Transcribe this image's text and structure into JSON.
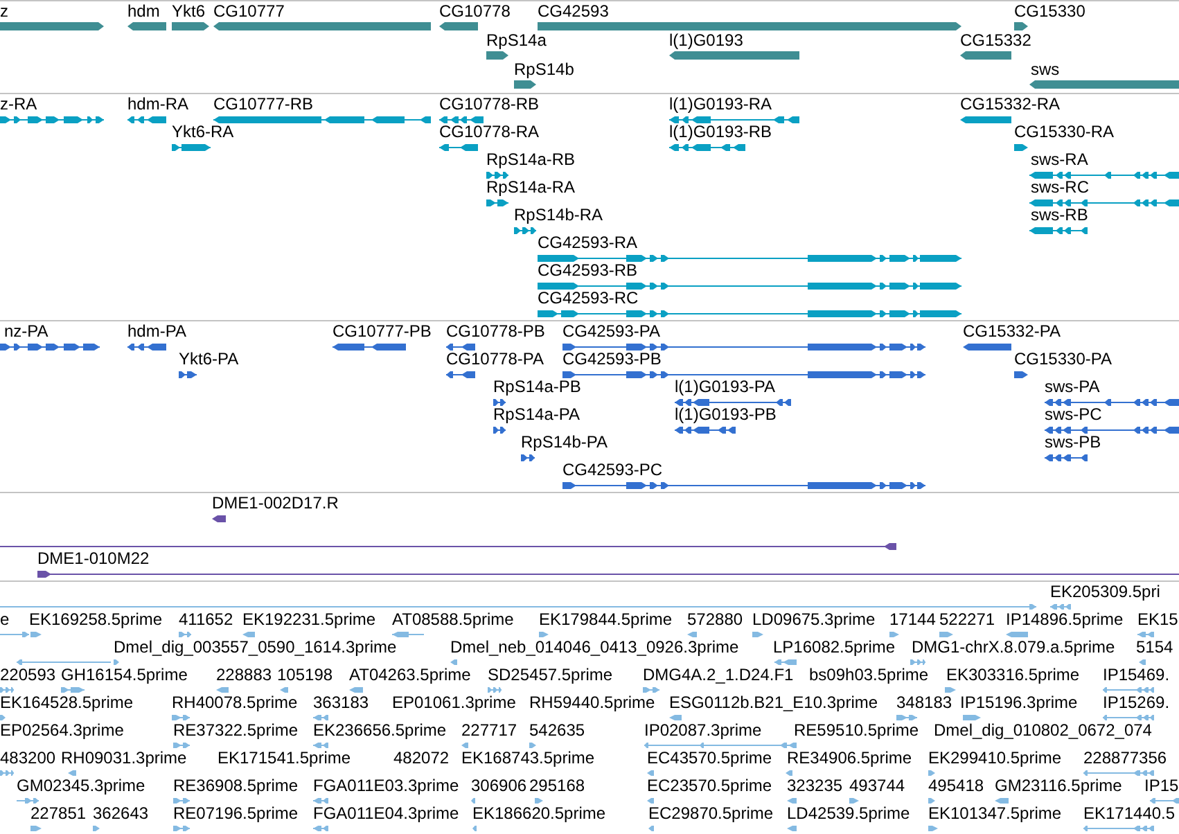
{
  "tracks": [
    {
      "kind": "gene",
      "rows": [
        {
          "features": [
            {
              "label": "z",
              "reverse": false
            },
            {
              "label": "hdm",
              "reverse": true
            },
            {
              "label": "Ykt6",
              "reverse": false
            },
            {
              "label": "CG10777",
              "reverse": true
            },
            {
              "label": "CG10778",
              "reverse": true
            },
            {
              "label": "CG42593",
              "reverse": false
            },
            {
              "label": "CG15330",
              "reverse": false
            }
          ]
        },
        {
          "features": [
            {
              "label": "RpS14a",
              "reverse": false
            },
            {
              "label": "l(1)G0193",
              "reverse": true
            },
            {
              "label": "CG15332",
              "reverse": true
            }
          ]
        },
        {
          "features": [
            {
              "label": "RpS14b",
              "reverse": false
            },
            {
              "label": "sws",
              "reverse": true
            }
          ]
        }
      ]
    },
    {
      "kind": "transcript",
      "rows": [
        {
          "features": [
            {
              "label": "z-RA",
              "reverse": false
            },
            {
              "label": "hdm-RA",
              "reverse": true
            },
            {
              "label": "CG10777-RB",
              "reverse": true
            },
            {
              "label": "CG10778-RB",
              "reverse": true
            },
            {
              "label": "l(1)G0193-RA",
              "reverse": true
            },
            {
              "label": "CG15332-RA",
              "reverse": true
            }
          ]
        },
        {
          "features": [
            {
              "label": "Ykt6-RA",
              "reverse": false
            },
            {
              "label": "CG10778-RA",
              "reverse": true
            },
            {
              "label": "l(1)G0193-RB",
              "reverse": true
            },
            {
              "label": "CG15330-RA",
              "reverse": false
            }
          ]
        },
        {
          "features": [
            {
              "label": "RpS14a-RB",
              "reverse": false
            },
            {
              "label": "sws-RA",
              "reverse": true
            }
          ]
        },
        {
          "features": [
            {
              "label": "RpS14a-RA",
              "reverse": false
            },
            {
              "label": "sws-RC",
              "reverse": true
            }
          ]
        },
        {
          "features": [
            {
              "label": "RpS14b-RA",
              "reverse": false
            },
            {
              "label": "sws-RB",
              "reverse": true
            }
          ]
        },
        {
          "features": [
            {
              "label": "CG42593-RA",
              "reverse": false
            }
          ]
        },
        {
          "features": [
            {
              "label": "CG42593-RB",
              "reverse": false
            }
          ]
        },
        {
          "features": [
            {
              "label": "CG42593-RC",
              "reverse": false
            }
          ]
        }
      ]
    },
    {
      "kind": "protein",
      "rows": [
        {
          "features": [
            {
              "label": "nz-PA",
              "reverse": false
            },
            {
              "label": "hdm-PA",
              "reverse": true
            },
            {
              "label": "CG10777-PB",
              "reverse": true
            },
            {
              "label": "CG10778-PB",
              "reverse": true
            },
            {
              "label": "CG42593-PA",
              "reverse": false
            },
            {
              "label": "CG15332-PA",
              "reverse": true
            }
          ]
        },
        {
          "features": [
            {
              "label": "Ykt6-PA",
              "reverse": false
            },
            {
              "label": "CG10778-PA",
              "reverse": true
            },
            {
              "label": "CG42593-PB",
              "reverse": false
            },
            {
              "label": "CG15330-PA",
              "reverse": false
            }
          ]
        },
        {
          "features": [
            {
              "label": "RpS14a-PB",
              "reverse": false
            },
            {
              "label": "l(1)G0193-PA",
              "reverse": true
            },
            {
              "label": "sws-PA",
              "reverse": true
            }
          ]
        },
        {
          "features": [
            {
              "label": "RpS14a-PA",
              "reverse": false
            },
            {
              "label": "l(1)G0193-PB",
              "reverse": true
            },
            {
              "label": "sws-PC",
              "reverse": true
            }
          ]
        },
        {
          "features": [
            {
              "label": "RpS14b-PA",
              "reverse": false
            },
            {
              "label": "sws-PB",
              "reverse": true
            }
          ]
        },
        {
          "features": [
            {
              "label": "CG42593-PC",
              "reverse": false
            }
          ]
        }
      ]
    },
    {
      "kind": "clone",
      "rows": [
        {
          "features": [
            {
              "label": "DME1-002D17.R",
              "reverse": true
            }
          ]
        },
        {
          "features": [
            {
              "reverse": true
            }
          ]
        },
        {
          "features": [
            {
              "label": "DME1-010M22",
              "reverse": false
            }
          ]
        }
      ]
    },
    {
      "kind": "est",
      "rows": [
        {
          "features": [
            {
              "reverse": false
            },
            {
              "label": "EK205309.5pri",
              "reverse": true
            }
          ]
        },
        {
          "features": [
            {
              "label": "e",
              "reverse": false
            },
            {
              "label": "EK169258.5prime",
              "reverse": false
            },
            {
              "label": "411652",
              "reverse": false
            },
            {
              "label": "EK192231.5prime",
              "reverse": true
            },
            {
              "label": "AT08588.5prime",
              "reverse": true
            },
            {
              "label": "EK179844.5prime",
              "reverse": false
            },
            {
              "label": "572880",
              "reverse": true
            },
            {
              "label": "LD09675.3prime",
              "reverse": false
            },
            {
              "label": "17144",
              "reverse": false
            },
            {
              "label": "522271",
              "reverse": false
            },
            {
              "label": "IP14896.5prime",
              "reverse": true
            },
            {
              "label": "EK15",
              "reverse": true
            }
          ]
        },
        {
          "features": [
            {
              "reverse": true
            },
            {
              "label": "Dmel_dig_003557_0590_1614.3prime",
              "reverse": false
            },
            {
              "label": "Dmel_neb_014046_0413_0926.3prime",
              "reverse": true
            },
            {
              "label": "LP16082.5prime",
              "reverse": true
            },
            {
              "label": "DMG1-chrX.8.079.a.5prime",
              "reverse": false
            },
            {
              "label": "5154",
              "reverse": true
            }
          ]
        },
        {
          "features": [
            {
              "label": "220593",
              "reverse": false
            },
            {
              "label": "GH16154.5prime",
              "reverse": false
            },
            {
              "label": "228883",
              "reverse": true
            },
            {
              "label": "105198",
              "reverse": true
            },
            {
              "label": "AT04263.5prime",
              "reverse": true
            },
            {
              "label": "SD25457.5prime",
              "reverse": false
            },
            {
              "label": "DMG4A.2_1.D24.F1",
              "reverse": false
            },
            {
              "label": "bs09h03.5prime"
            },
            {
              "label": "EK303316.5prime",
              "reverse": false
            },
            {
              "label": "IP15469.",
              "reverse": true
            }
          ]
        },
        {
          "features": [
            {
              "label": "EK164528.5prime",
              "reverse": false
            },
            {
              "label": "RH40078.5prime",
              "reverse": false
            },
            {
              "label": "363183",
              "reverse": true
            },
            {
              "label": "EP01061.3prime"
            },
            {
              "label": "RH59440.5prime"
            },
            {
              "label": "ESG0112b.B21_E10.3prime",
              "reverse": true
            },
            {
              "label": "348183",
              "reverse": false
            },
            {
              "label": "IP15196.3prime",
              "reverse": false
            },
            {
              "label": "IP15269.",
              "reverse": true
            }
          ]
        },
        {
          "features": [
            {
              "label": "EP02564.3prime"
            },
            {
              "label": "RE37322.5prime",
              "reverse": false
            },
            {
              "label": "EK236656.5prime",
              "reverse": true
            },
            {
              "label": "227717",
              "reverse": true
            },
            {
              "label": "542635",
              "reverse": false
            },
            {
              "label": "IP02087.3prime",
              "reverse": true
            },
            {
              "label": "RE59510.5prime"
            },
            {
              "label": "Dmel_dig_010802_0672_074"
            }
          ]
        },
        {
          "features": [
            {
              "label": "483200",
              "reverse": false
            },
            {
              "label": "RH09031.3prime",
              "reverse": true
            },
            {
              "label": "EK171541.5prime"
            },
            {
              "label": "482072"
            },
            {
              "label": "EK168743.5prime"
            },
            {
              "label": "EC43570.5prime",
              "reverse": true
            },
            {
              "label": "RE34906.5prime",
              "reverse": true
            },
            {
              "label": "EK299410.5prime",
              "reverse": false
            },
            {
              "label": "228877356",
              "reverse": true
            }
          ]
        },
        {
          "features": [
            {
              "label": "GM02345.3prime",
              "reverse": false
            },
            {
              "label": "RE36908.5prime",
              "reverse": false
            },
            {
              "label": "FGA011E03.3prime",
              "reverse": true
            },
            {
              "label": "306906",
              "reverse": true
            },
            {
              "label": "295168",
              "reverse": false
            },
            {
              "label": "EC23570.5prime",
              "reverse": true
            },
            {
              "label": "323235",
              "reverse": true
            },
            {
              "label": "493744",
              "reverse": false
            },
            {
              "label": "495418",
              "reverse": false
            },
            {
              "label": "GM23116.5prime",
              "reverse": true
            },
            {
              "label": "IP15",
              "reverse": true
            }
          ]
        },
        {
          "features": [
            {
              "label": "227851",
              "reverse": false
            },
            {
              "label": "362643",
              "reverse": false
            },
            {
              "label": "RE07196.5prime",
              "reverse": false
            },
            {
              "label": "FGA011E04.3prime",
              "reverse": true
            },
            {
              "label": "EK186620.5prime",
              "reverse": true
            },
            {
              "label": "EC29870.5prime",
              "reverse": true
            },
            {
              "label": "LD42539.5prime",
              "reverse": true
            },
            {
              "label": "EK101347.5prime",
              "reverse": false
            },
            {
              "label": "EK171440.5",
              "reverse": true
            }
          ]
        }
      ]
    }
  ]
}
